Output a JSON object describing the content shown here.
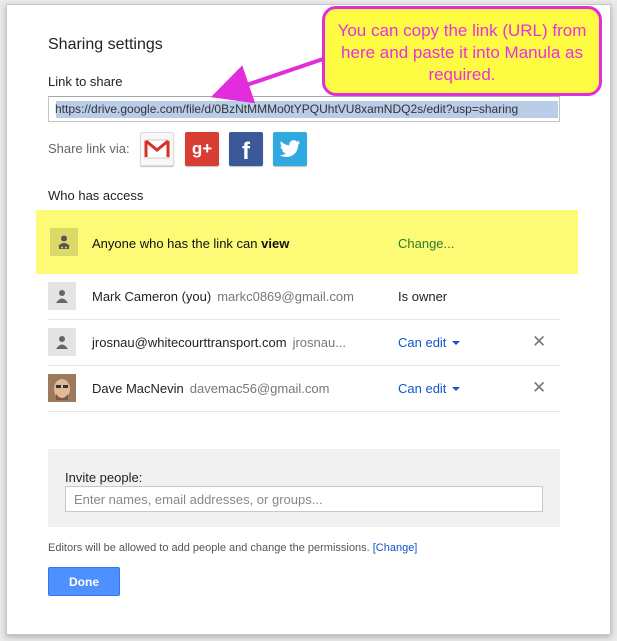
{
  "dialog": {
    "title": "Sharing settings",
    "link_label": "Link to share",
    "link_value": "https://drive.google.com/file/d/0BzNtMMMo0tYPQUhtVU8xamNDQ2s/edit?usp=sharing",
    "share_via_label": "Share link via:",
    "social": [
      {
        "name": "gmail-icon",
        "glyph": "M"
      },
      {
        "name": "google-plus-icon",
        "glyph": "g+"
      },
      {
        "name": "facebook-icon",
        "glyph": "f"
      },
      {
        "name": "twitter-icon",
        "glyph": "t"
      }
    ],
    "who_label": "Who has access",
    "anyone_row": {
      "text_prefix": "Anyone who has the link can",
      "text_bold": "view",
      "change": "Change..."
    },
    "people": [
      {
        "name": "Mark Cameron (you)",
        "email": "markc0869@gmail.com",
        "permission": "Is owner"
      },
      {
        "name": "jrosnau@whitecourttransport.com",
        "email": "jrosnau...",
        "permission": "Can edit"
      },
      {
        "name": "Dave MacNevin",
        "email": "davemac56@gmail.com",
        "permission": "Can edit"
      }
    ],
    "remove_glyph": "✕",
    "invite_label": "Invite people:",
    "invite_placeholder": "Enter names, email addresses, or groups...",
    "editors_note": "Editors will be allowed to add people and change the permissions.",
    "editors_change": "[Change]",
    "done_label": "Done"
  },
  "callout": {
    "text": "You can copy the link (URL) from here and paste it into Manula as required."
  },
  "colors": {
    "accent_blue": "#4d90fe",
    "link_blue": "#1155cc",
    "highlight_yellow": "#fdfb76",
    "callout_magenta": "#e32ddc"
  }
}
